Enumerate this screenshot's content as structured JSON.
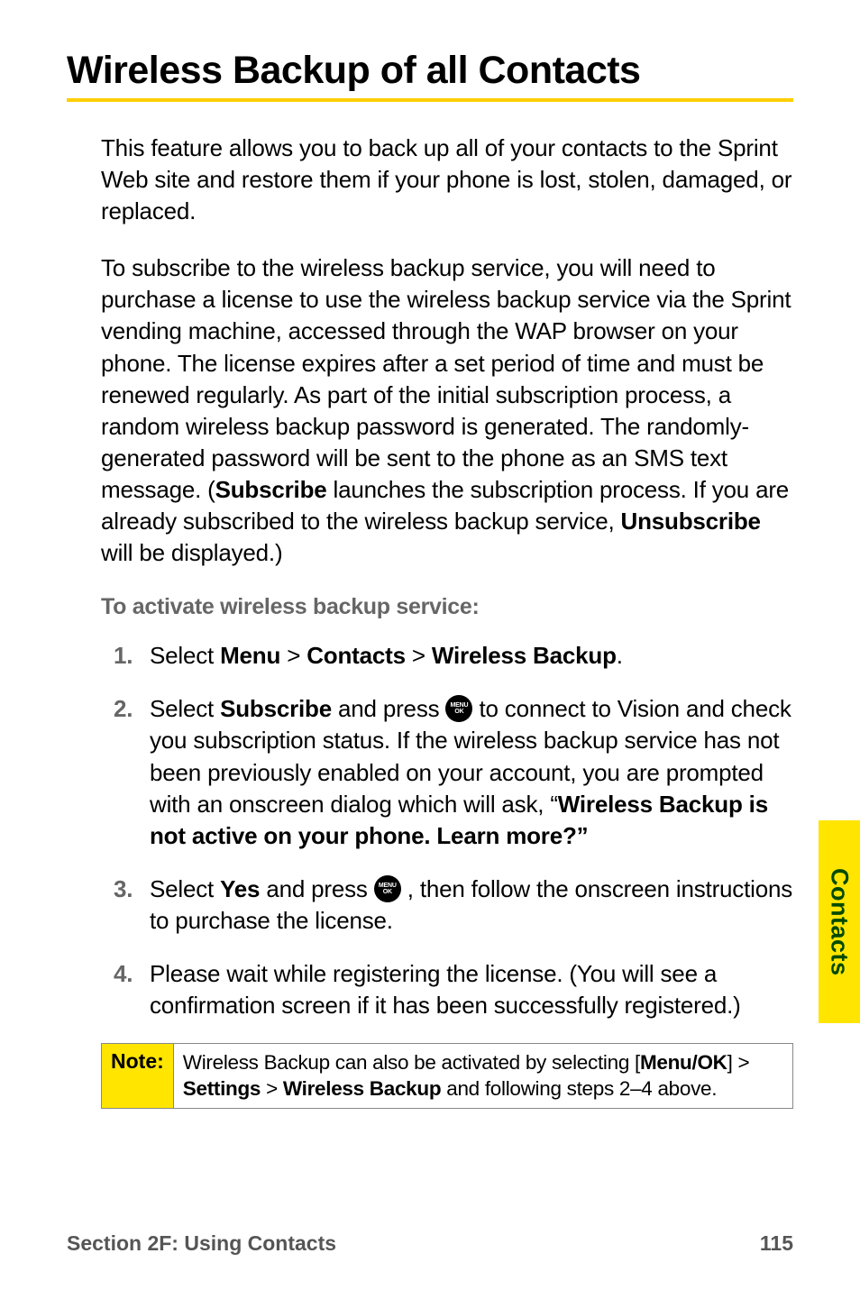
{
  "title": "Wireless Backup of all Contacts",
  "intro_para": "This feature allows you to back up all of your contacts to the Sprint Web site and restore them if your phone is lost, stolen, damaged, or replaced.",
  "service_para_pre": "To subscribe to the wireless backup service, you will need to purchase a license to use the wireless backup service via the Sprint vending machine, accessed through the WAP browser on your phone. The license expires after a set period of time and must be renewed regularly. As part of the initial subscription process, a random wireless backup password is generated. The randomly-generated password will be sent to the phone as an SMS text message. (",
  "subscribe_word": "Subscribe",
  "service_para_mid": " launches the subscription process. If you are already subscribed to the wireless backup service, ",
  "unsubscribe_word": "Unsubscribe",
  "service_para_post": " will be displayed.)",
  "procedure_heading": "To activate wireless backup service:",
  "steps": {
    "s1": {
      "num": "1.",
      "pre": "Select ",
      "b1": "Menu",
      "sep1": " > ",
      "b2": "Contacts",
      "sep2": " > ",
      "b3": "Wireless Backup",
      "post": "."
    },
    "s2": {
      "num": "2.",
      "pre": "Select ",
      "b1": "Subscribe",
      "mid1": " and press ",
      "mid2": " to connect to Vision and check you subscription status. If the wireless backup service has not been previously enabled on your account, you are prompted with an onscreen dialog which will ask, “",
      "b2": "Wireless Backup is not active on your phone. Learn more?”"
    },
    "s3": {
      "num": "3.",
      "pre": "Select ",
      "b1": "Yes",
      "mid1": " and press ",
      "post": ", then follow the onscreen instructions to purchase the license."
    },
    "s4": {
      "num": "4.",
      "text": "Please wait while registering the license. (You will see a confirmation screen if it has been successfully registered.)"
    }
  },
  "icon": {
    "line1": "MENU",
    "line2": "OK"
  },
  "note": {
    "label": "Note:",
    "pre": "Wireless Backup can also be activated by selecting [",
    "b1": "Menu/OK",
    "mid1": "] > ",
    "b2": "Settings",
    "mid2": " > ",
    "b3": "Wireless Backup",
    "post": " and following steps 2–4 above."
  },
  "side_tab": "Contacts",
  "footer": {
    "section": "Section 2F: Using Contacts",
    "page": "115"
  }
}
